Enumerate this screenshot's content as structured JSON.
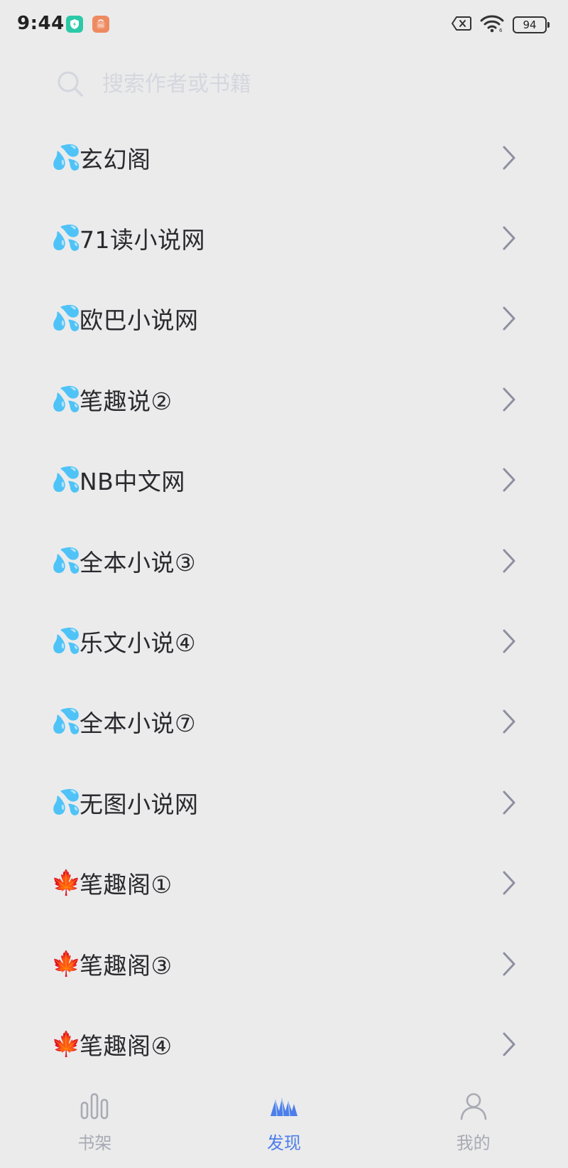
{
  "status_bar": {
    "time": "9:44",
    "battery": "94",
    "icons": [
      "shield-app-icon",
      "mi-store-icon",
      "no-sim-icon",
      "wifi-icon",
      "battery-icon"
    ]
  },
  "search": {
    "placeholder": "搜索作者或书籍",
    "value": ""
  },
  "sources": [
    {
      "icon": "💦",
      "icon_name": "sweat-drops-icon",
      "label": "玄幻阁"
    },
    {
      "icon": "💦",
      "icon_name": "sweat-drops-icon",
      "label": "71读小说网"
    },
    {
      "icon": "💦",
      "icon_name": "sweat-drops-icon",
      "label": "欧巴小说网"
    },
    {
      "icon": "💦",
      "icon_name": "sweat-drops-icon",
      "label": "笔趣说②"
    },
    {
      "icon": "💦",
      "icon_name": "sweat-drops-icon",
      "label": "NB中文网"
    },
    {
      "icon": "💦",
      "icon_name": "sweat-drops-icon",
      "label": "全本小说③"
    },
    {
      "icon": "💦",
      "icon_name": "sweat-drops-icon",
      "label": "乐文小说④"
    },
    {
      "icon": "💦",
      "icon_name": "sweat-drops-icon",
      "label": "全本小说⑦"
    },
    {
      "icon": "💦",
      "icon_name": "sweat-drops-icon",
      "label": "无图小说网"
    },
    {
      "icon": "🍁",
      "icon_name": "maple-leaf-icon",
      "label": "笔趣阁①"
    },
    {
      "icon": "🍁",
      "icon_name": "maple-leaf-icon",
      "label": "笔趣阁③"
    },
    {
      "icon": "🍁",
      "icon_name": "maple-leaf-icon",
      "label": "笔趣阁④"
    }
  ],
  "bottom_nav": {
    "bookshelf": "书架",
    "discover": "发现",
    "mine": "我的",
    "active": "discover"
  },
  "colors": {
    "background": "#EBEBEC",
    "accent": "#4D7EE8",
    "inactive": "#A9AAB3",
    "chevron": "#8E8FA0"
  }
}
